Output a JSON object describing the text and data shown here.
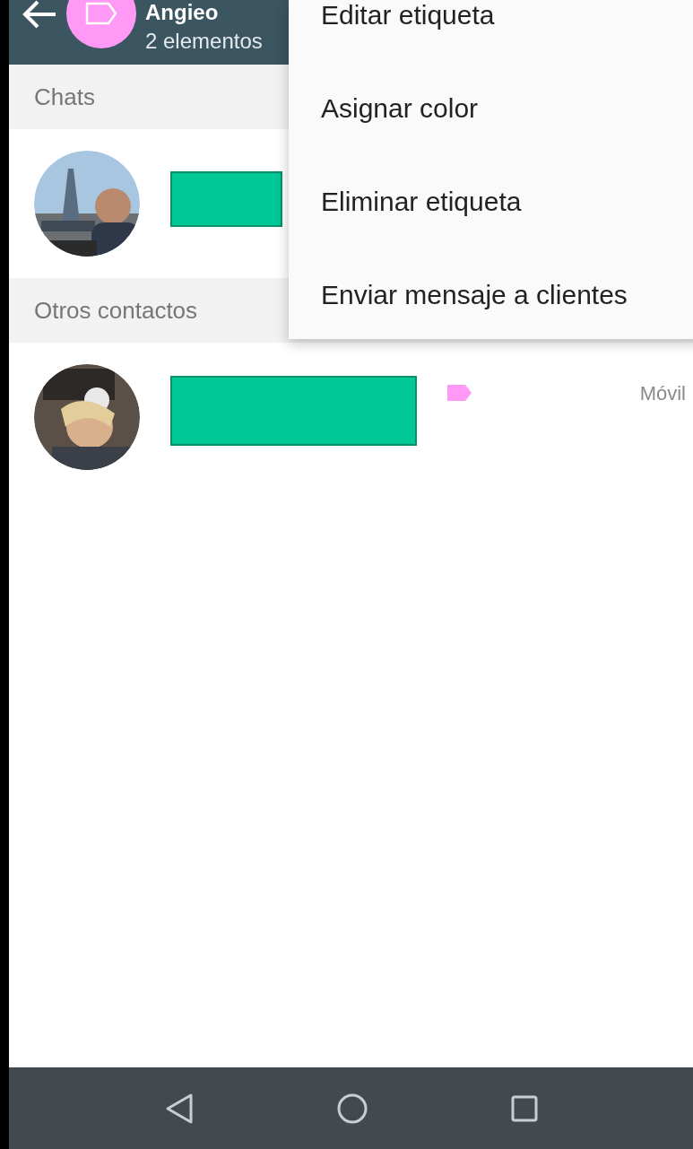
{
  "header": {
    "title": "Angieo",
    "subtitle": "2 elementos",
    "color": "#ff99f5"
  },
  "sections": [
    {
      "title": "Chats"
    },
    {
      "title": "Otros contactos",
      "rows": [
        {
          "kind": "picture",
          "tag": true,
          "time": "Móvil"
        }
      ]
    }
  ],
  "menu": {
    "items": [
      "Editar etiqueta",
      "Asignar color",
      "Eliminar etiqueta",
      "Enviar mensaje a clientes"
    ]
  }
}
